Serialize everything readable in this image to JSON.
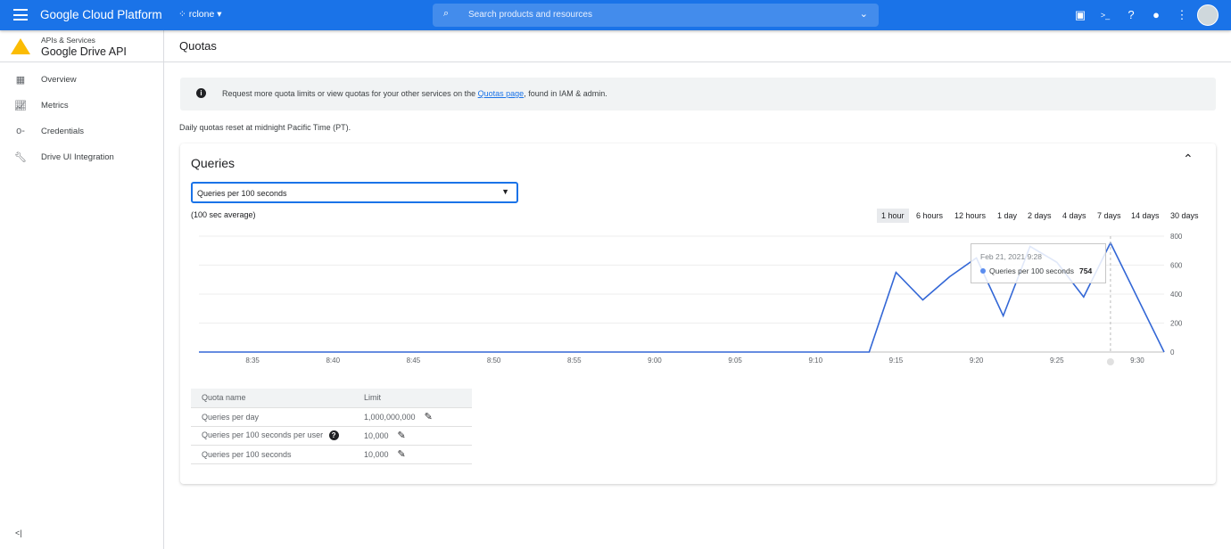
{
  "topbar": {
    "title": "Google Cloud Platform",
    "project": "rclone",
    "search_placeholder": "Search products and resources",
    "icons": [
      "gift-icon",
      "cloud-shell-icon",
      "help-icon",
      "bell-icon",
      "more-vert-icon",
      "avatar"
    ]
  },
  "sidebar": {
    "section": "APIs & Services",
    "api": "Google Drive API",
    "items": [
      {
        "label": "Overview",
        "icon": "dashboard-icon"
      },
      {
        "label": "Metrics",
        "icon": "metrics-icon"
      },
      {
        "label": "Credentials",
        "icon": "key-icon"
      },
      {
        "label": "Drive UI Integration",
        "icon": "wrench-icon"
      }
    ],
    "collapse": "<|"
  },
  "page": {
    "title": "Quotas",
    "banner_pre": "Request more quota limits or view quotas for your other services on the ",
    "banner_link": "Quotas page",
    "banner_post": ", found in IAM & admin.",
    "reset_note": "Daily quotas reset at midnight Pacific Time (PT)."
  },
  "card": {
    "title": "Queries",
    "select_value": "Queries per 100 seconds",
    "avg_note": "(100 sec average)",
    "ranges": [
      "1 hour",
      "6 hours",
      "12 hours",
      "1 day",
      "2 days",
      "4 days",
      "7 days",
      "14 days",
      "30 days"
    ],
    "selected_range": "1 hour"
  },
  "tooltip": {
    "date": "Feb 21, 2021 9:28",
    "series": "Queries per 100 seconds",
    "value": "754"
  },
  "chart_data": {
    "type": "line",
    "series": [
      {
        "name": "Queries per 100 seconds",
        "color": "#3367d6",
        "x": [
          "8:31:40",
          "9:13:20",
          "9:15:00",
          "9:16:40",
          "9:18:20",
          "9:20:00",
          "9:21:40",
          "9:23:20",
          "9:25:00",
          "9:26:40",
          "9:28:20",
          "9:31:40"
        ],
        "y": [
          0,
          0,
          550,
          360,
          520,
          650,
          250,
          730,
          620,
          380,
          754,
          0
        ]
      }
    ],
    "xlim": [
      "8:31:40",
      "9:31:40"
    ],
    "ylim": [
      0,
      800
    ],
    "xticks": [
      "8:35",
      "8:40",
      "8:45",
      "8:50",
      "8:55",
      "9:00",
      "9:05",
      "9:10",
      "9:15",
      "9:20",
      "9:25",
      "9:30"
    ],
    "yticks": [
      "0",
      "200",
      "400",
      "600",
      "800"
    ],
    "grid": true
  },
  "table": {
    "headers": [
      "Quota name",
      "Limit"
    ],
    "rows": [
      {
        "name": "Queries per day",
        "limit": "1,000,000,000"
      },
      {
        "name": "Queries per 100 seconds per user",
        "limit": "10,000",
        "help": true
      },
      {
        "name": "Queries per 100 seconds",
        "limit": "10,000"
      }
    ]
  }
}
